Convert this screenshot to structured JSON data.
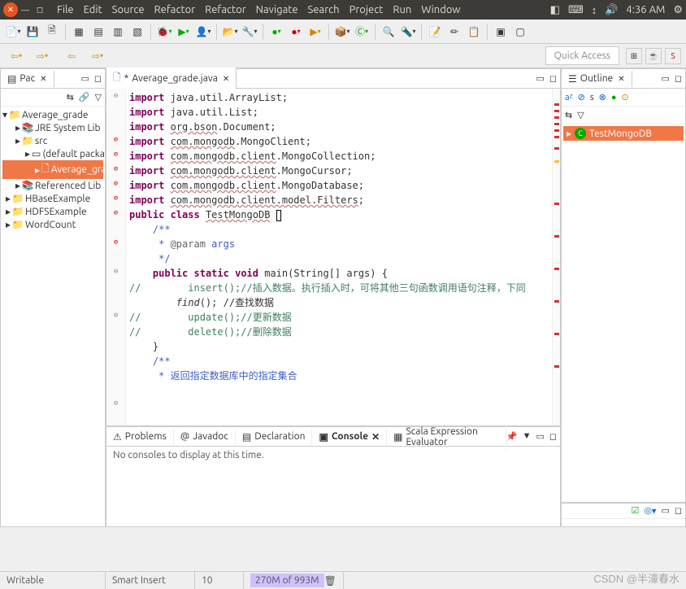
{
  "menubar": [
    "File",
    "Edit",
    "Source",
    "Refactor",
    "Refactor",
    "Navigate",
    "Search",
    "Project",
    "Run",
    "Window"
  ],
  "systray": {
    "time": "4:36 AM"
  },
  "quick_access": "Quick Access",
  "package_explorer": {
    "tab": "Pac",
    "root": "Average_grade",
    "items": [
      {
        "label": "JRE System Lib",
        "indent": 1,
        "icon": "lib"
      },
      {
        "label": "src",
        "indent": 1,
        "icon": "folder"
      },
      {
        "label": "(default packa",
        "indent": 2,
        "icon": "pkg"
      },
      {
        "label": "Average_gra",
        "indent": 3,
        "icon": "java",
        "sel": true
      },
      {
        "label": "Referenced Lib",
        "indent": 1,
        "icon": "lib"
      },
      {
        "label": "HBaseExample",
        "indent": 0,
        "icon": "proj"
      },
      {
        "label": "HDFSExample",
        "indent": 0,
        "icon": "proj"
      },
      {
        "label": "WordCount",
        "indent": 0,
        "icon": "proj"
      }
    ]
  },
  "editor": {
    "tab": "Average_grade.java",
    "modified": true,
    "lines": [
      {
        "t": "import java.util.ArrayList;",
        "g": "fold"
      },
      {
        "t": "import java.util.List;"
      },
      {
        "t": ""
      },
      {
        "t": "import org.bson.Document;",
        "g": "err",
        "und": "org.bson"
      },
      {
        "t": "import com.mongodb.MongoClient;",
        "g": "err",
        "und": "com.mongodb"
      },
      {
        "t": "import com.mongodb.client.MongoCollection;",
        "g": "err",
        "und": "com.mongodb.client"
      },
      {
        "t": "import com.mongodb.client.MongoCursor;",
        "g": "err",
        "und": "com.mongodb.client"
      },
      {
        "t": "import com.mongodb.client.MongoDatabase;",
        "g": "err",
        "und": "com.mongodb.client"
      },
      {
        "t": "import com.mongodb.client.model.Filters;",
        "g": "err",
        "und": "com.mongodb.client.model.Filters"
      },
      {
        "t": ""
      },
      {
        "t": "public class TestMongoDB {",
        "g": "err",
        "cls": true
      },
      {
        "t": ""
      },
      {
        "t": "    /**",
        "g": "fold"
      },
      {
        "t": "     * @param args"
      },
      {
        "t": "     */"
      },
      {
        "t": "    public static void main(String[] args) {",
        "g": "fold"
      },
      {
        "t": "//        insert();//插入数据。执行插入时，可将其他三句函数调用语句注释，下同"
      },
      {
        "t": "        find(); //查找数据",
        "fnund": "find"
      },
      {
        "t": "//        update();//更新数据"
      },
      {
        "t": "//        delete();//删除数据"
      },
      {
        "t": "    }"
      },
      {
        "t": "    /**",
        "g": "fold"
      },
      {
        "t": "     * 返回指定数据库中的指定集合"
      }
    ]
  },
  "outline": {
    "tab": "Outline",
    "item": "TestMongoDB"
  },
  "bottom": {
    "tabs": [
      "Problems",
      "Javadoc",
      "Declaration",
      "Console",
      "Scala Expression Evaluator"
    ],
    "active": 3,
    "body": "No consoles to display at this time."
  },
  "statusbar": {
    "mode": "Writable",
    "insert": "Smart Insert",
    "pos": "10",
    "mem": "270M of 993M"
  },
  "watermark": "CSDN @半濠春水"
}
